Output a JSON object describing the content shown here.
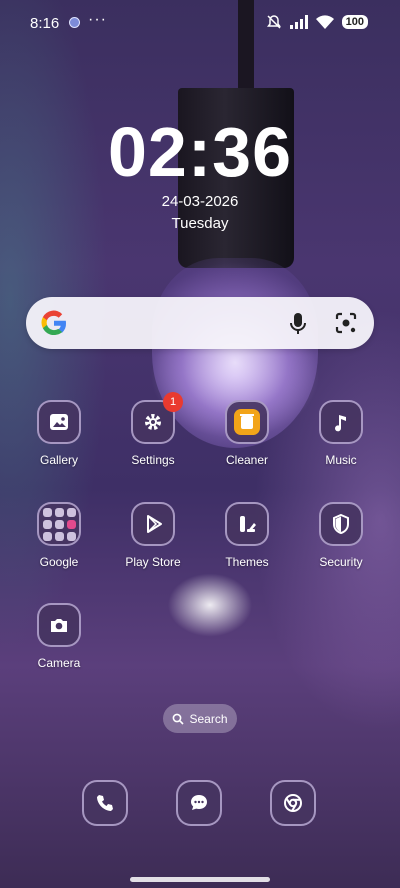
{
  "status_bar": {
    "time": "8:16",
    "more": "···",
    "battery": "100"
  },
  "clock": {
    "time": "02:36",
    "date": "24-03-2026",
    "weekday": "Tuesday"
  },
  "search_widget": {
    "logo": "google-logo",
    "mic": "mic-icon",
    "lens": "lens-icon"
  },
  "apps": [
    {
      "label": "Gallery",
      "icon": "image-icon"
    },
    {
      "label": "Settings",
      "icon": "gear-icon",
      "badge": "1"
    },
    {
      "label": "Cleaner",
      "icon": "trash-icon"
    },
    {
      "label": "Music",
      "icon": "music-note-icon"
    },
    {
      "label": "Google",
      "icon": "folder-icon"
    },
    {
      "label": "Play Store",
      "icon": "play-icon"
    },
    {
      "label": "Themes",
      "icon": "themes-icon"
    },
    {
      "label": "Security",
      "icon": "shield-icon"
    },
    {
      "label": "Camera",
      "icon": "camera-icon"
    }
  ],
  "app_search": {
    "label": "Search"
  },
  "dock": [
    {
      "icon": "phone-icon"
    },
    {
      "icon": "messages-icon"
    },
    {
      "icon": "chrome-icon"
    }
  ],
  "colors": {
    "badge": "#ea3a2f",
    "cleaner": "#f2a419",
    "tile_bg": "#463460"
  }
}
